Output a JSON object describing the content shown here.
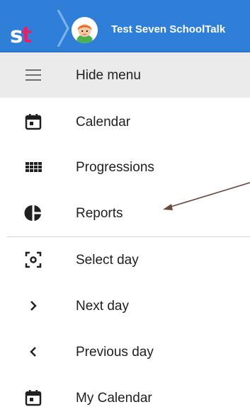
{
  "header": {
    "logo_text_s": "s",
    "logo_text_t": "t",
    "user_name": "Test Seven SchoolTalk"
  },
  "menu": {
    "toggle_label": "Hide menu",
    "items": [
      {
        "label": "Calendar",
        "icon": "calendar-icon"
      },
      {
        "label": "Progressions",
        "icon": "grid-icon"
      },
      {
        "label": "Reports",
        "icon": "pie-chart-icon"
      },
      {
        "label": "Select day",
        "icon": "center-focus-icon"
      },
      {
        "label": "Next day",
        "icon": "chevron-right-icon"
      },
      {
        "label": "Previous day",
        "icon": "chevron-left-icon"
      },
      {
        "label": "My Calendar",
        "icon": "calendar-icon"
      }
    ]
  },
  "colors": {
    "topbar": "#2f7fd8",
    "logo_accent": "#e4226b",
    "menu_header_bg": "#ebebeb",
    "annotation_arrow": "#6b4a3a"
  }
}
